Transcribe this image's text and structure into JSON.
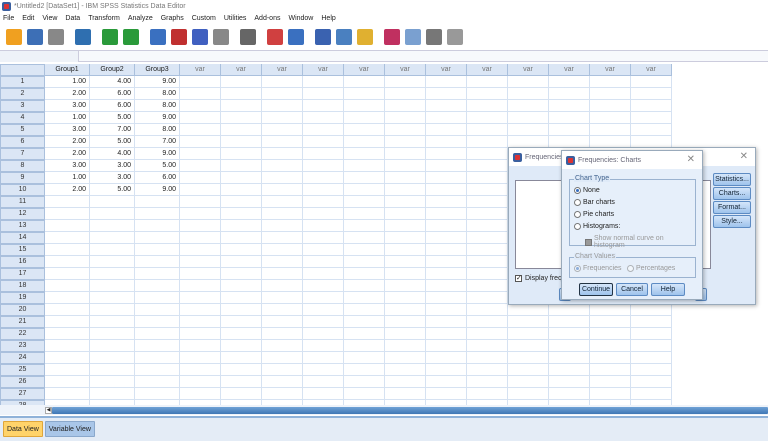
{
  "window": {
    "title": "*Untitled2 [DataSet1] - IBM SPSS Statistics Data Editor"
  },
  "menu": [
    "File",
    "Edit",
    "View",
    "Data",
    "Transform",
    "Analyze",
    "Graphs",
    "Custom",
    "Utilities",
    "Add-ons",
    "Window",
    "Help"
  ],
  "toolbar": [
    "open-icon",
    "save-icon",
    "print-icon",
    "dialog-recall-icon",
    "undo-icon",
    "redo-icon",
    "goto-case-icon",
    "goto-variable-icon",
    "variables-icon",
    "run-descriptive-icon",
    "find-icon",
    "insert-cases-icon",
    "insert-variable-icon",
    "split-file-icon",
    "weight-cases-icon",
    "select-cases-icon",
    "value-labels-icon",
    "use-sets-icon",
    "show-all-variables-icon",
    "spell-check-icon"
  ],
  "grid": {
    "columns": [
      "Group1",
      "Group2",
      "Group3",
      "var",
      "var",
      "var",
      "var",
      "var",
      "var",
      "var",
      "var",
      "var",
      "var",
      "var",
      "var"
    ],
    "rows": [
      [
        "1.00",
        "4.00",
        "9.00"
      ],
      [
        "2.00",
        "6.00",
        "8.00"
      ],
      [
        "3.00",
        "6.00",
        "8.00"
      ],
      [
        "1.00",
        "5.00",
        "9.00"
      ],
      [
        "3.00",
        "7.00",
        "8.00"
      ],
      [
        "2.00",
        "5.00",
        "7.00"
      ],
      [
        "2.00",
        "4.00",
        "9.00"
      ],
      [
        "3.00",
        "3.00",
        "5.00"
      ],
      [
        "1.00",
        "3.00",
        "6.00"
      ],
      [
        "2.00",
        "5.00",
        "9.00"
      ]
    ],
    "row_count": 28
  },
  "tabs": {
    "data_view": "Data View",
    "variable_view": "Variable View"
  },
  "freq": {
    "title": "Frequencies",
    "display": "Display freq",
    "buttons": [
      "Statistics...",
      "Charts...",
      "Format...",
      "Style..."
    ]
  },
  "charts": {
    "title": "Frequencies: Charts",
    "chart_type": "Chart Type",
    "none": "None",
    "bar": "Bar charts",
    "pie": "Pie charts",
    "hist": "Histograms:",
    "normal": "Show normal curve on histogram",
    "chart_values": "Chart Values",
    "frequencies": "Frequencies",
    "percentages": "Percentages",
    "continue": "Continue",
    "cancel": "Cancel",
    "help": "Help",
    "selected": "None"
  }
}
